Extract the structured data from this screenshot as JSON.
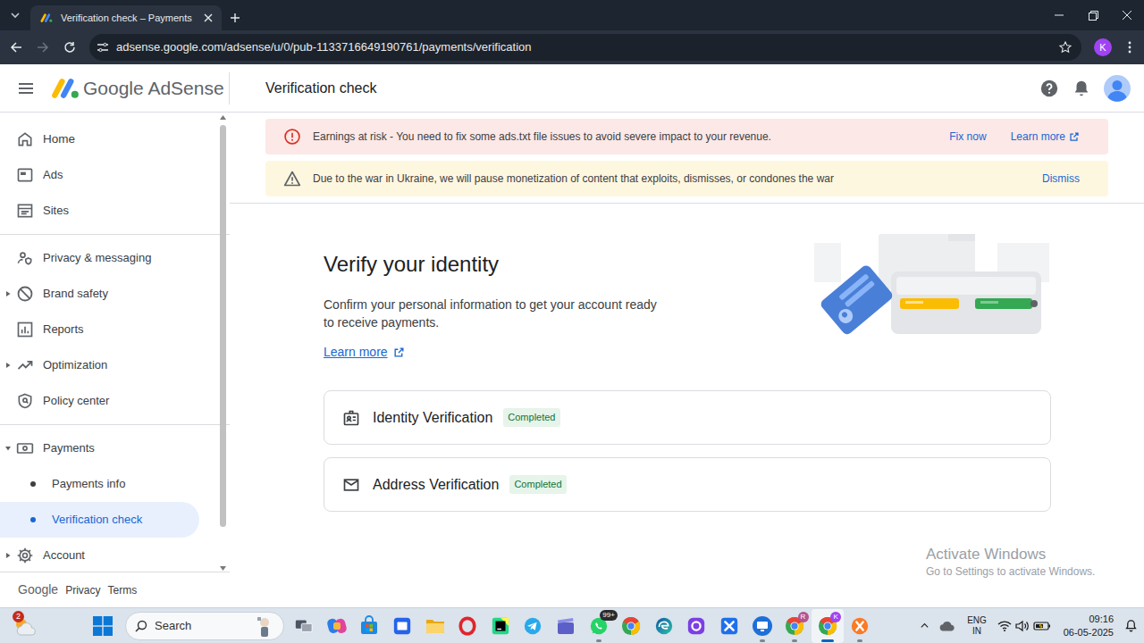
{
  "browser": {
    "tabs": [
      {
        "title": "Verification check – Payments",
        "selected": true
      }
    ],
    "url": "adsense.google.com/adsense/u/0/pub-1133716649190761/payments/verification",
    "profile_initial": "K"
  },
  "header": {
    "logo_text": "Google AdSense",
    "page_title": "Verification check"
  },
  "sidebar": {
    "groups": [
      [
        {
          "label": "Home",
          "kind": "item",
          "selected": false
        },
        {
          "label": "Ads",
          "kind": "item",
          "selected": false
        },
        {
          "label": "Sites",
          "kind": "item",
          "selected": false
        }
      ],
      [
        {
          "label": "Privacy & messaging",
          "kind": "item",
          "selected": false
        },
        {
          "label": "Brand safety",
          "kind": "item",
          "selected": false,
          "expanded": false
        },
        {
          "label": "Reports",
          "kind": "item",
          "selected": false
        },
        {
          "label": "Optimization",
          "kind": "item",
          "selected": false,
          "expanded": false
        },
        {
          "label": "Policy center",
          "kind": "item",
          "selected": false
        }
      ],
      [
        {
          "label": "Payments",
          "kind": "item",
          "selected": false,
          "expanded": true
        },
        {
          "label": "Payments info",
          "kind": "sub",
          "selected": false
        },
        {
          "label": "Verification check",
          "kind": "sub",
          "selected": true
        },
        {
          "label": "Account",
          "kind": "item",
          "selected": false,
          "expanded": false
        }
      ]
    ],
    "footer": [
      "Google",
      "Privacy",
      "Terms"
    ]
  },
  "alerts": [
    {
      "kind": "error",
      "text": "Earnings at risk - You need to fix some ads.txt file issues to avoid severe impact to your revenue.",
      "actions": [
        "Fix now",
        "Learn more"
      ]
    },
    {
      "kind": "warning",
      "text": "Due to the war in Ukraine, we will pause monetization of content that exploits, dismisses, or condones the war",
      "actions": [
        "Dismiss"
      ]
    }
  ],
  "main": {
    "heading": "Verify your identity",
    "description": "Confirm your personal information to get your account ready to receive payments.",
    "learn_more": "Learn more",
    "steps": [
      {
        "label": "Identity Verification",
        "status": "Completed"
      },
      {
        "label": "Address Verification",
        "status": "Completed"
      }
    ]
  },
  "watermark": {
    "title": "Activate Windows",
    "subtitle": "Go to Settings to activate Windows."
  },
  "taskbar": {
    "weather_badge": "2",
    "search": "Search",
    "apps": [
      {
        "running": false,
        "selected": false
      },
      {
        "running": false,
        "selected": false
      },
      {
        "running": false,
        "selected": false
      },
      {
        "running": false,
        "selected": false
      },
      {
        "running": false,
        "selected": false
      },
      {
        "running": false,
        "selected": false
      },
      {
        "running": false,
        "selected": false
      },
      {
        "running": false,
        "selected": false
      },
      {
        "running": false,
        "selected": false
      },
      {
        "running": true,
        "selected": false,
        "badge": "99+"
      },
      {
        "running": false,
        "selected": false
      },
      {
        "running": false,
        "selected": false
      },
      {
        "running": false,
        "selected": false
      },
      {
        "running": false,
        "selected": false
      },
      {
        "running": true,
        "selected": false
      },
      {
        "running": true,
        "selected": false,
        "badge": "R"
      },
      {
        "running": true,
        "selected": true,
        "badge": "K"
      },
      {
        "running": true,
        "selected": false
      }
    ],
    "tray": {
      "language": "ENG",
      "region": "IN",
      "time": "09:16",
      "date": "06-05-2025"
    }
  }
}
